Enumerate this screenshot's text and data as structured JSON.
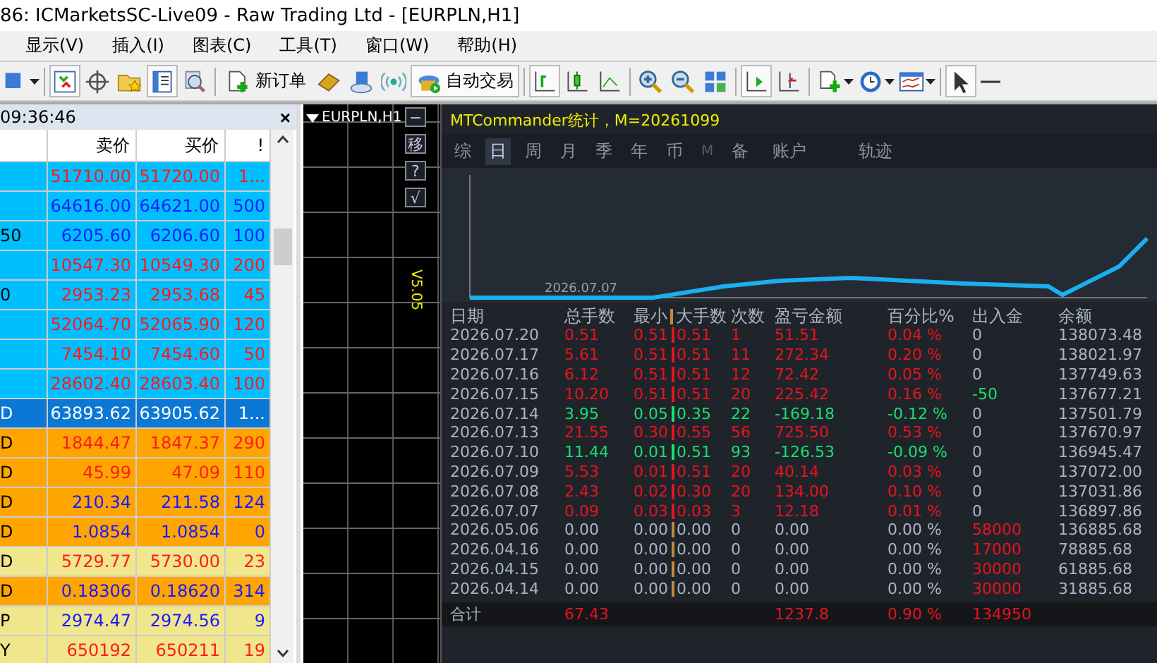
{
  "window": {
    "title": "86: ICMarketsSC-Live09 - Raw Trading Ltd - [EURPLN,H1]"
  },
  "menu": [
    "显示(V)",
    "插入(I)",
    "图表(C)",
    "工具(T)",
    "窗口(W)",
    "帮助(H)"
  ],
  "toolbar": [
    {
      "pressed": false
    },
    {
      "pressed": true
    },
    {
      "pressed": false
    },
    {
      "pressed": false
    },
    {
      "pressed": true
    },
    {
      "pressed": false
    },
    {
      "pressed": false,
      "label": "新订单"
    },
    {
      "pressed": false
    },
    {
      "pressed": false
    },
    {
      "pressed": false
    },
    {
      "pressed": true,
      "label": "自动交易"
    },
    {
      "pressed": true
    },
    {
      "pressed": false
    },
    {
      "pressed": false
    },
    {
      "pressed": false
    },
    {
      "pressed": false
    },
    {
      "pressed": false
    },
    {
      "pressed": true
    },
    {
      "pressed": false
    },
    {
      "pressed": false
    },
    {
      "pressed": false
    },
    {
      "pressed": false
    },
    {
      "pressed": true
    },
    {
      "pressed": false
    }
  ],
  "market_watch": {
    "time": "09:36:46",
    "close": "×",
    "columns": [
      "卖价",
      "买价",
      "!"
    ],
    "rows": [
      {
        "symbol": "",
        "bid": "51710.00",
        "ask": "51720.00",
        "spread": "1...",
        "falling": true,
        "color": "#00bfff",
        "selected": false
      },
      {
        "symbol": "",
        "bid": "64616.00",
        "ask": "64621.00",
        "spread": "500",
        "falling": false,
        "color": "#00bfff",
        "selected": false
      },
      {
        "symbol": "50",
        "bid": "6205.60",
        "ask": "6206.60",
        "spread": "100",
        "falling": false,
        "color": "#00bfff",
        "selected": false
      },
      {
        "symbol": "",
        "bid": "10547.30",
        "ask": "10549.30",
        "spread": "200",
        "falling": true,
        "color": "#00bfff",
        "selected": false
      },
      {
        "symbol": "0",
        "bid": "2953.23",
        "ask": "2953.68",
        "spread": "45",
        "falling": true,
        "color": "#00bfff",
        "selected": false
      },
      {
        "symbol": "",
        "bid": "52064.70",
        "ask": "52065.90",
        "spread": "120",
        "falling": true,
        "color": "#00bfff",
        "selected": false
      },
      {
        "symbol": "",
        "bid": "7454.10",
        "ask": "7454.60",
        "spread": "50",
        "falling": true,
        "color": "#00bfff",
        "selected": false
      },
      {
        "symbol": "",
        "bid": "28602.40",
        "ask": "28603.40",
        "spread": "100",
        "falling": true,
        "color": "#00bfff",
        "selected": false
      },
      {
        "symbol": "D",
        "bid": "63893.62",
        "ask": "63905.62",
        "spread": "1...",
        "color": "#0a78d4",
        "selected": true
      },
      {
        "symbol": "D",
        "bid": "1844.47",
        "ask": "1847.37",
        "spread": "290",
        "falling": true,
        "color": "#ffa500",
        "selected": false
      },
      {
        "symbol": "D",
        "bid": "45.99",
        "ask": "47.09",
        "spread": "110",
        "falling": true,
        "color": "#ffa500",
        "selected": false
      },
      {
        "symbol": "D",
        "bid": "210.34",
        "ask": "211.58",
        "spread": "124",
        "falling": false,
        "color": "#ffa500",
        "selected": false
      },
      {
        "symbol": "D",
        "bid": "1.0854",
        "ask": "1.0854",
        "spread": "0",
        "falling": false,
        "color": "#ffa500",
        "selected": false
      },
      {
        "symbol": "D",
        "bid": "5729.77",
        "ask": "5730.00",
        "spread": "23",
        "falling": true,
        "color": "#f0e68c",
        "selected": false
      },
      {
        "symbol": "D",
        "bid": "0.18306",
        "ask": "0.18620",
        "spread": "314",
        "falling": false,
        "color": "#ffa500",
        "selected": false
      },
      {
        "symbol": "P",
        "bid": "2974.47",
        "ask": "2974.56",
        "spread": "9",
        "falling": false,
        "color": "#f0e68c",
        "selected": false
      },
      {
        "symbol": "Y",
        "bid": "650192",
        "ask": "650211",
        "spread": "19",
        "falling": true,
        "color": "#f0e68c",
        "selected": false
      }
    ]
  },
  "chart": {
    "symbol": "EURPLN,H1",
    "side_buttons": [
      "−",
      "移",
      "?",
      "√"
    ],
    "version": "V5.05"
  },
  "stats": {
    "title": "MTCommander统计，M=20261099",
    "tabs": [
      {
        "label": "综",
        "selected": false,
        "disabled": false
      },
      {
        "label": "日",
        "selected": true,
        "disabled": false
      },
      {
        "label": "周",
        "selected": false,
        "disabled": false
      },
      {
        "label": "月",
        "selected": false,
        "disabled": false
      },
      {
        "label": "季",
        "selected": false,
        "disabled": false
      },
      {
        "label": "年",
        "selected": false,
        "disabled": false
      },
      {
        "label": "币",
        "selected": false,
        "disabled": false
      },
      {
        "label": "M",
        "selected": false,
        "disabled": true
      },
      {
        "label": "备",
        "selected": false,
        "disabled": false
      },
      {
        "label": "账户",
        "selected": false,
        "disabled": false
      },
      {
        "label": "轨迹",
        "selected": false,
        "disabled": false
      }
    ],
    "curve_label": "2026.07.07",
    "columns": [
      "日期",
      "总手数",
      "最小",
      "大手数",
      "次数",
      "盈亏金额",
      "百分比%",
      "出入金",
      "余额"
    ],
    "rows": [
      {
        "date": "2026.07.20",
        "lots": "0.51",
        "min": "0.51",
        "separator": {
          "color": "#e8141e"
        },
        "max": "0.51",
        "count": "1",
        "pnl": "51.51",
        "pct": "0.04 %",
        "flow": {
          "text": "0",
          "color": "#aab4c4"
        },
        "balance": "138073.48",
        "color": "#e8141e"
      },
      {
        "date": "2026.07.17",
        "lots": "5.61",
        "min": "0.51",
        "separator": {
          "color": "#e8141e"
        },
        "max": "0.51",
        "count": "11",
        "pnl": "272.34",
        "pct": "0.20 %",
        "flow": {
          "text": "0",
          "color": "#aab4c4"
        },
        "balance": "138021.97",
        "color": "#e8141e"
      },
      {
        "date": "2026.07.16",
        "lots": "6.12",
        "min": "0.51",
        "separator": {
          "color": "#e8141e"
        },
        "max": "0.51",
        "count": "12",
        "pnl": "72.42",
        "pct": "0.05 %",
        "flow": {
          "text": "0",
          "color": "#aab4c4"
        },
        "balance": "137749.63",
        "color": "#e8141e"
      },
      {
        "date": "2026.07.15",
        "lots": "10.20",
        "min": "0.51",
        "separator": {
          "color": "#e8141e"
        },
        "max": "0.51",
        "count": "20",
        "pnl": "225.42",
        "pct": "0.16 %",
        "flow": {
          "text": "-50",
          "color": "#18e070"
        },
        "balance": "137677.21",
        "color": "#e8141e"
      },
      {
        "date": "2026.07.14",
        "lots": "3.95",
        "min": "0.05",
        "separator": {
          "color": "#18e070"
        },
        "max": "0.35",
        "count": "22",
        "pnl": "-169.18",
        "pct": "-0.12 %",
        "flow": {
          "text": "0",
          "color": "#aab4c4"
        },
        "balance": "137501.79",
        "color": "#18e070"
      },
      {
        "date": "2026.07.13",
        "lots": "21.55",
        "min": "0.30",
        "separator": {
          "color": "#e8141e"
        },
        "max": "0.55",
        "count": "56",
        "pnl": "725.50",
        "pct": "0.53 %",
        "flow": {
          "text": "0",
          "color": "#aab4c4"
        },
        "balance": "137670.97",
        "color": "#e8141e"
      },
      {
        "date": "2026.07.10",
        "lots": "11.44",
        "min": "0.01",
        "separator": {
          "color": "#18e070"
        },
        "max": "0.51",
        "count": "93",
        "pnl": "-126.53",
        "pct": "-0.09 %",
        "flow": {
          "text": "0",
          "color": "#aab4c4"
        },
        "balance": "136945.47",
        "color": "#18e070"
      },
      {
        "date": "2026.07.09",
        "lots": "5.53",
        "min": "0.01",
        "separator": {
          "color": "#e8141e"
        },
        "max": "0.51",
        "count": "20",
        "pnl": "40.14",
        "pct": "0.03 %",
        "flow": {
          "text": "0",
          "color": "#aab4c4"
        },
        "balance": "137072.00",
        "color": "#e8141e"
      },
      {
        "date": "2026.07.08",
        "lots": "2.43",
        "min": "0.02",
        "separator": {
          "color": "#e8141e"
        },
        "max": "0.30",
        "count": "20",
        "pnl": "134.00",
        "pct": "0.10 %",
        "flow": {
          "text": "0",
          "color": "#aab4c4"
        },
        "balance": "137031.86",
        "color": "#e8141e"
      },
      {
        "date": "2026.07.07",
        "lots": "0.09",
        "min": "0.03",
        "separator": {
          "color": "#e8141e"
        },
        "max": "0.03",
        "count": "3",
        "pnl": "12.18",
        "pct": "0.01 %",
        "flow": {
          "text": "0",
          "color": "#aab4c4"
        },
        "balance": "136897.86",
        "color": "#e8141e"
      },
      {
        "date": "2026.05.06",
        "lots": "0.00",
        "min": "0.00",
        "separator": {
          "color": "#c08a3a"
        },
        "max": "0.00",
        "count": "0",
        "pnl": "0.00",
        "pct": "0.00 %",
        "flow": {
          "text": "58000",
          "color": "#e8141e"
        },
        "balance": "136885.68",
        "color": "#aab4c4"
      },
      {
        "date": "2026.04.16",
        "lots": "0.00",
        "min": "0.00",
        "separator": {
          "color": "#c08a3a"
        },
        "max": "0.00",
        "count": "0",
        "pnl": "0.00",
        "pct": "0.00 %",
        "flow": {
          "text": "17000",
          "color": "#e8141e"
        },
        "balance": "78885.68",
        "color": "#aab4c4"
      },
      {
        "date": "2026.04.15",
        "lots": "0.00",
        "min": "0.00",
        "separator": {
          "color": "#c08a3a"
        },
        "max": "0.00",
        "count": "0",
        "pnl": "0.00",
        "pct": "0.00 %",
        "flow": {
          "text": "30000",
          "color": "#e8141e"
        },
        "balance": "61885.68",
        "color": "#aab4c4"
      },
      {
        "date": "2026.04.14",
        "lots": "0.00",
        "min": "0.00",
        "separator": {
          "color": "#c08a3a"
        },
        "max": "0.00",
        "count": "0",
        "pnl": "0.00",
        "pct": "0.00 %",
        "flow": {
          "text": "30000",
          "color": "#e8141e"
        },
        "balance": "31885.68",
        "color": "#aab4c4"
      }
    ],
    "total": {
      "label": "合计",
      "lots": "67.43",
      "pnl": "1237.8",
      "pct": "0.90 %",
      "flow": "134950"
    }
  }
}
